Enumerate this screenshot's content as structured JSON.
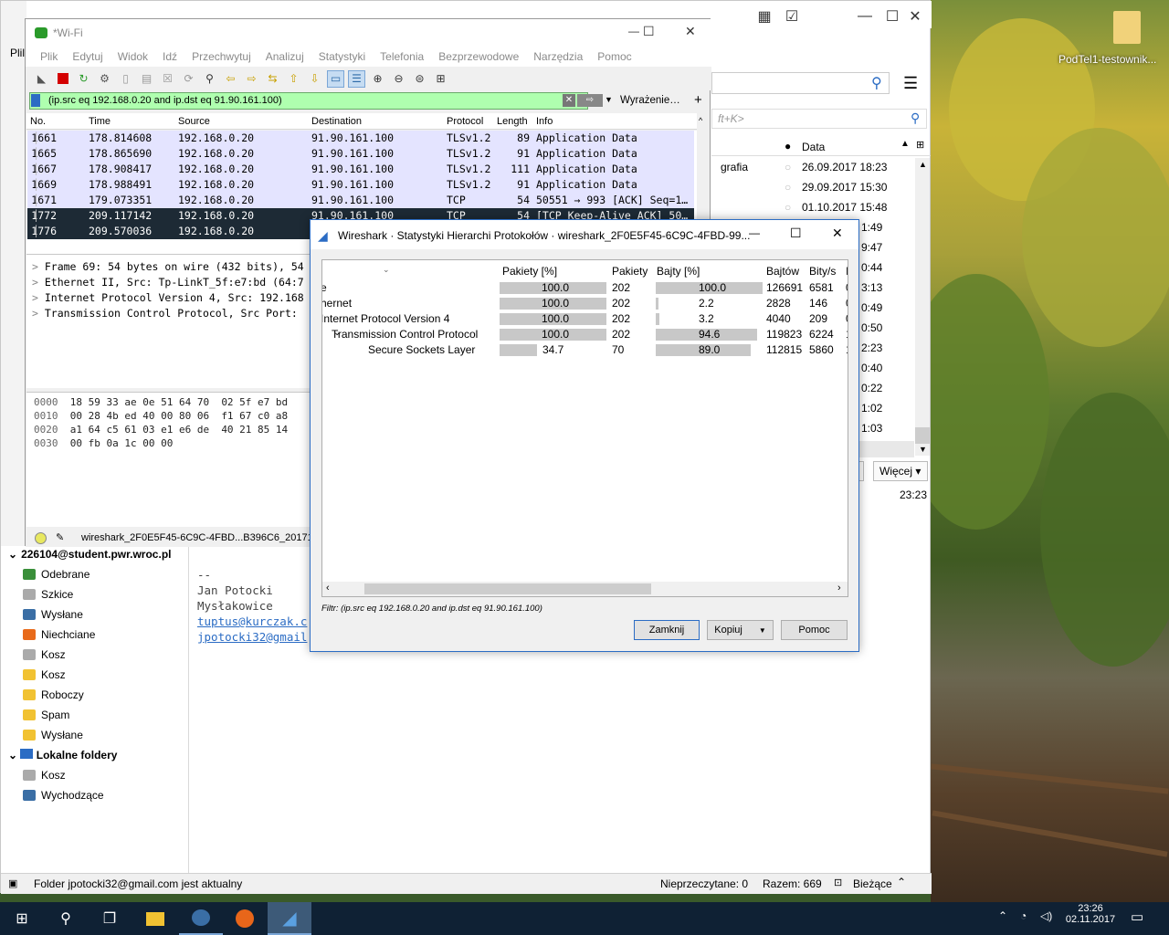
{
  "desktop": {
    "icon_label": "PodTel1-testownik..."
  },
  "thunderbird": {
    "search_placeholder": "ft+K>",
    "col_data": "Data",
    "rows": [
      {
        "subject": "grafia",
        "date": "26.09.2017 18:23"
      },
      {
        "subject": "",
        "date": "29.09.2017 15:30"
      },
      {
        "subject": "",
        "date": "01.10.2017 15:48"
      }
    ],
    "partial_times": [
      "1:49",
      "9:47",
      "0:44",
      "3:13",
      "0:49",
      "0:50",
      "2:23",
      "0:40",
      "0:22",
      "1:02",
      "1:03"
    ],
    "more_button": "Więcej",
    "partial_button": "i",
    "msg_time": "23:23",
    "account": "226104@student.pwr.wroc.pl",
    "folders": [
      "Odebrane",
      "Szkice",
      "Wysłane",
      "Niechciane",
      "Kosz",
      "Kosz",
      "Roboczy",
      "Spam",
      "Wysłane"
    ],
    "local_folders": "Lokalne foldery",
    "local_items": [
      "Kosz",
      "Wychodzące"
    ],
    "signature": [
      "--",
      "Jan Potocki",
      "Mysłakowice",
      "tuptus@kurczak.c",
      "jpotocki32@gmail"
    ],
    "status_text": "Folder jpotocki32@gmail.com jest aktualny",
    "unread": "Nieprzeczytane: 0",
    "total": "Razem: 669",
    "view": "Bieżące",
    "left_partial": "Plil"
  },
  "wireshark": {
    "title": "*Wi-Fi",
    "menu": [
      "Plik",
      "Edytuj",
      "Widok",
      "Idź",
      "Przechwytuj",
      "Analizuj",
      "Statystyki",
      "Telefonia",
      "Bezprzewodowe",
      "Narzędzia",
      "Pomoc"
    ],
    "filter": "(ip.src eq 192.168.0.20 and ip.dst eq 91.90.161.100)",
    "expression_button": "Wyrażenie…",
    "columns": [
      "No.",
      "Time",
      "Source",
      "Destination",
      "Protocol",
      "Length",
      "Info"
    ],
    "packets": [
      {
        "no": "1661",
        "time": "178.814608",
        "src": "192.168.0.20",
        "dst": "91.90.161.100",
        "proto": "TLSv1.2",
        "len": "89",
        "info": "Application Data",
        "style": "tls"
      },
      {
        "no": "1665",
        "time": "178.865690",
        "src": "192.168.0.20",
        "dst": "91.90.161.100",
        "proto": "TLSv1.2",
        "len": "91",
        "info": "Application Data",
        "style": "tls"
      },
      {
        "no": "1667",
        "time": "178.908417",
        "src": "192.168.0.20",
        "dst": "91.90.161.100",
        "proto": "TLSv1.2",
        "len": "111",
        "info": "Application Data",
        "style": "tls"
      },
      {
        "no": "1669",
        "time": "178.988491",
        "src": "192.168.0.20",
        "dst": "91.90.161.100",
        "proto": "TLSv1.2",
        "len": "91",
        "info": "Application Data",
        "style": "tls"
      },
      {
        "no": "1671",
        "time": "179.073351",
        "src": "192.168.0.20",
        "dst": "91.90.161.100",
        "proto": "TCP",
        "len": "54",
        "info": "50551 → 993 [ACK] Seq=1…",
        "style": "tls"
      },
      {
        "no": "1772",
        "time": "209.117142",
        "src": "192.168.0.20",
        "dst": "91.90.161.100",
        "proto": "TCP",
        "len": "54",
        "info": "[TCP Keep-Alive ACK] 50…",
        "style": "dark"
      },
      {
        "no": "1776",
        "time": "209.570036",
        "src": "192.168.0.20",
        "dst": "",
        "proto": "",
        "len": "",
        "info": "",
        "style": "dark"
      }
    ],
    "details": [
      "Frame 69: 54 bytes on wire (432 bits), 54",
      "Ethernet II, Src: Tp-LinkT_5f:e7:bd (64:7",
      "Internet Protocol Version 4, Src: 192.168",
      "Transmission Control Protocol, Src Port:"
    ],
    "hex": [
      {
        "off": "0000",
        "bytes": "18 59 33 ae 0e 51 64 70  02 5f e7 bd"
      },
      {
        "off": "0010",
        "bytes": "00 28 4b ed 40 00 80 06  f1 67 c0 a8"
      },
      {
        "off": "0020",
        "bytes": "a1 64 c5 61 03 e1 e6 de  40 21 85 14"
      },
      {
        "off": "0030",
        "bytes": "00 fb 0a 1c 00 00"
      }
    ],
    "status_file": "wireshark_2F0E5F45-6C9C-4FBD...B396C6_2017110"
  },
  "dialog": {
    "title": "Wireshark · Statystyki Hierarchi Protokołów · wireshark_2F0E5F45-6C9C-4FBD-99...",
    "columns": [
      "Pakiety [%]",
      "Pakiety",
      "Bajty [%]",
      "Bajtów",
      "Bity/s",
      "I"
    ],
    "rows": [
      {
        "name": "e",
        "indent": 0,
        "pkt_pct": "100.0",
        "pkt_frac": 1.0,
        "pkts": "202",
        "byte_pct": "100.0",
        "byte_frac": 1.0,
        "bytes": "126691",
        "bits": "6581",
        "extra": "0"
      },
      {
        "name": "hernet",
        "indent": 0,
        "pkt_pct": "100.0",
        "pkt_frac": 1.0,
        "pkts": "202",
        "byte_pct": "2.2",
        "byte_frac": 0.022,
        "bytes": "2828",
        "bits": "146",
        "extra": "0"
      },
      {
        "name": "Internet Protocol Version 4",
        "indent": 1,
        "pkt_pct": "100.0",
        "pkt_frac": 1.0,
        "pkts": "202",
        "byte_pct": "3.2",
        "byte_frac": 0.032,
        "bytes": "4040",
        "bits": "209",
        "extra": "0"
      },
      {
        "name": "Transmission Control Protocol",
        "indent": 2,
        "pkt_pct": "100.0",
        "pkt_frac": 1.0,
        "pkts": "202",
        "byte_pct": "94.6",
        "byte_frac": 0.946,
        "bytes": "119823",
        "bits": "6224",
        "extra": "1"
      },
      {
        "name": "Secure Sockets Layer",
        "indent": 3,
        "pkt_pct": "34.7",
        "pkt_frac": 0.347,
        "pkts": "70",
        "byte_pct": "89.0",
        "byte_frac": 0.89,
        "bytes": "112815",
        "bits": "5860",
        "extra": "1"
      }
    ],
    "filter_label": "Filtr: (ip.src eq 192.168.0.20 and ip.dst eq 91.90.161.100)",
    "close": "Zamknij",
    "copy": "Kopiuj",
    "help": "Pomoc"
  },
  "taskbar": {
    "time": "23:26",
    "date": "02.11.2017"
  },
  "colors": {
    "tls_row": "#e4e4ff",
    "dark_row": "#1d2a35",
    "filter_ok": "#afffaf",
    "taskbar": "#0f2134",
    "accent": "#2b6cc4"
  }
}
